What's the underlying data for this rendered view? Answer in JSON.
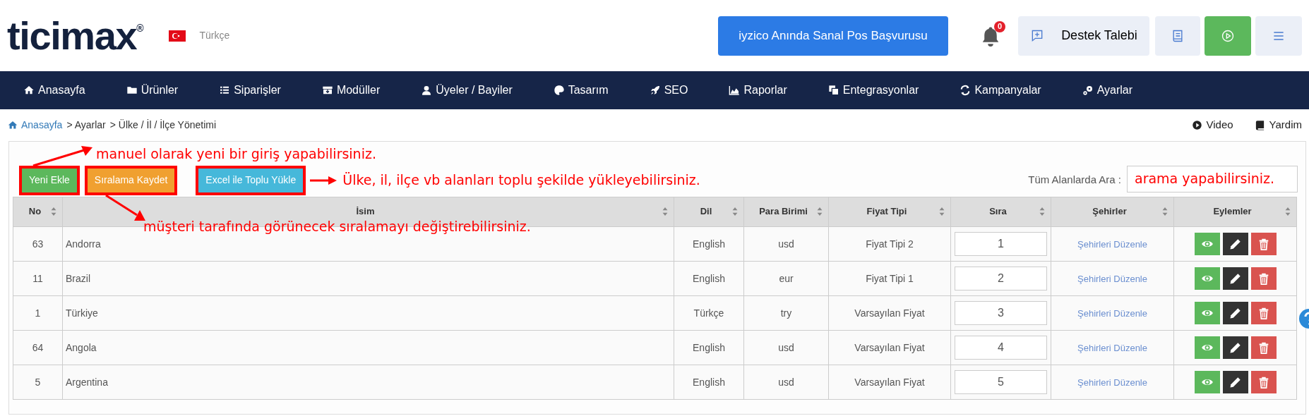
{
  "header": {
    "logo": "ticimax",
    "logo_mark": "®",
    "language": "Türkçe",
    "promo_button": "iyzico Anında Sanal Pos Başvurusu",
    "notification_count": "0",
    "support_button": "Destek Talebi"
  },
  "nav": [
    "Anasayfa",
    "Ürünler",
    "Siparişler",
    "Modüller",
    "Üyeler / Bayiler",
    "Tasarım",
    "SEO",
    "Raporlar",
    "Entegrasyonlar",
    "Kampanyalar",
    "Ayarlar"
  ],
  "breadcrumb": [
    {
      "label": "Anasayfa",
      "kind": "link"
    },
    {
      "label": "> Ayarlar",
      "kind": "text"
    },
    {
      "label": "> Ülke / İl / İlçe Yönetimi",
      "kind": "text"
    }
  ],
  "help_links": [
    "Video",
    "Yardim"
  ],
  "toolbar": [
    {
      "label": "Yeni Ekle",
      "kind": "success",
      "highlighted": true
    },
    {
      "label": "Sıralama Kaydet",
      "kind": "warning",
      "highlighted": true
    },
    {
      "label": "Excel ile Toplu Yükle",
      "kind": "info",
      "highlighted": true
    }
  ],
  "search": {
    "label": "Tüm Alanlarda Ara :"
  },
  "annotations": [
    {
      "text": "manuel olarak yeni bir giriş yapabilirsiniz.",
      "kind": "above"
    },
    {
      "text": "Ülke, il, ilçe vb alanları toplu şekilde yükleyebilirsiniz.",
      "kind": "right"
    },
    {
      "text": "müşteri tarafında görünecek sıralamayı değiştirebilirsiniz.",
      "kind": "below"
    },
    {
      "text": "arama yapabilirsiniz.",
      "kind": "in_field"
    }
  ],
  "table": {
    "columns": [
      "No",
      "İsim",
      "Dil",
      "Para Birimi",
      "Fiyat Tipi",
      "Sıra",
      "Şehirler",
      "Eylemler"
    ],
    "rows": [
      {
        "no": "63",
        "name": "Andorra",
        "language": "English",
        "currency": "usd",
        "price_type": "Fiyat Tipi 2",
        "order": "1",
        "cities": "Şehirleri Düzenle"
      },
      {
        "no": "11",
        "name": "Brazil",
        "language": "English",
        "currency": "eur",
        "price_type": "Fiyat Tipi 1",
        "order": "2",
        "cities": "Şehirleri Düzenle"
      },
      {
        "no": "1",
        "name": "Türkiye",
        "language": "Türkçe",
        "currency": "try",
        "price_type": "Varsayılan Fiyat",
        "order": "3",
        "cities": "Şehirleri Düzenle"
      },
      {
        "no": "64",
        "name": "Angola",
        "language": "English",
        "currency": "usd",
        "price_type": "Varsayılan Fiyat",
        "order": "4",
        "cities": "Şehirleri Düzenle"
      },
      {
        "no": "5",
        "name": "Argentina",
        "language": "English",
        "currency": "usd",
        "price_type": "Varsayılan Fiyat",
        "order": "5",
        "cities": "Şehirleri Düzenle"
      }
    ]
  }
}
